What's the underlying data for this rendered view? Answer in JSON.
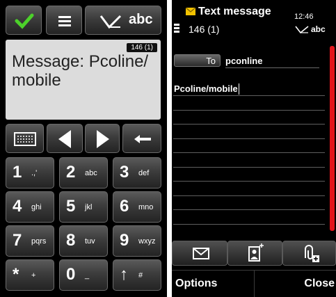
{
  "left_screen": {
    "toolbar": {
      "mode_label": "abc"
    },
    "display": {
      "counter": "146 (1)",
      "message": "Message: Pcoline/ mobile"
    },
    "keypad": [
      {
        "num": "1",
        "letters": ".,'"
      },
      {
        "num": "2",
        "letters": "abc"
      },
      {
        "num": "3",
        "letters": "def"
      },
      {
        "num": "4",
        "letters": "ghi"
      },
      {
        "num": "5",
        "letters": "jkl"
      },
      {
        "num": "6",
        "letters": "mno"
      },
      {
        "num": "7",
        "letters": "pqrs"
      },
      {
        "num": "8",
        "letters": "tuv"
      },
      {
        "num": "9",
        "letters": "wxyz"
      },
      {
        "num": "*",
        "letters": "+"
      },
      {
        "num": "0",
        "letters": "_"
      },
      {
        "num": "↑",
        "letters": "#"
      }
    ],
    "icons": [
      "checkmark-icon",
      "menu-icon",
      "pen-icon",
      "keyboard-icon",
      "arrow-left-icon",
      "arrow-right-icon",
      "backspace-icon"
    ],
    "colors": {
      "accent_green": "#4cd12a",
      "display_bg": "#dcdcdc"
    }
  },
  "right_screen": {
    "status": {
      "title": "Text message",
      "time": "12:46",
      "counter": "146 (1)",
      "mode": "abc"
    },
    "to": {
      "label": "To",
      "value": "pconline"
    },
    "body_text": "Pcoline/mobile",
    "toolbar_icons": [
      "envelope-icon",
      "contact-book-icon",
      "attachment-icon"
    ],
    "softkeys": {
      "left": "Options",
      "right": "Close"
    },
    "colors": {
      "scrollbar": "#e3141b",
      "envelope": "#f2c200"
    }
  }
}
